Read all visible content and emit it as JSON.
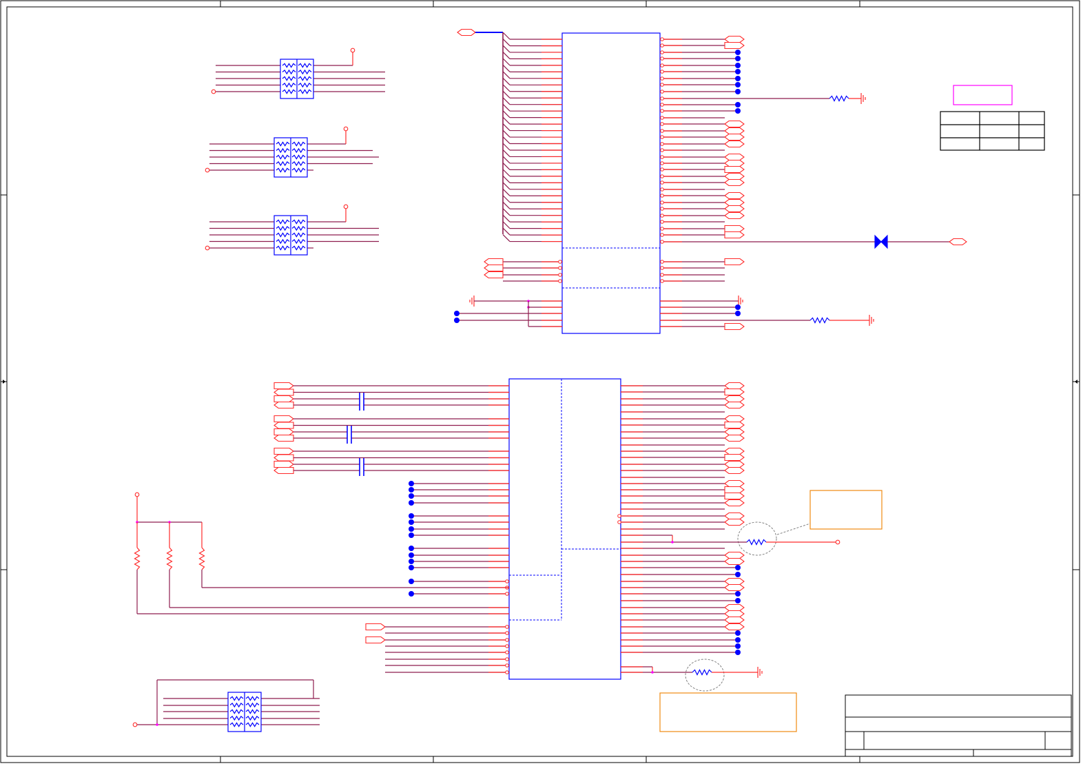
{
  "colors": {
    "frame": "#000000",
    "wire": "#8e1c4e",
    "pin": "#ff2a2a",
    "component": "#0000ff",
    "junction": "#0000ff",
    "junction_small": "#ff00ff",
    "port": "#ff2a2a",
    "note_box": "#f08a10",
    "highlight_box": "#ff00ff",
    "dashed_circle": "#808080",
    "background": "#ffffff"
  },
  "icons": {
    "ground": "ground-symbol",
    "resistor": "resistor-symbol",
    "capacitor": "capacitor-symbol",
    "diode": "diode-symbol",
    "port": "port-flag",
    "junction": "junction-dot"
  }
}
